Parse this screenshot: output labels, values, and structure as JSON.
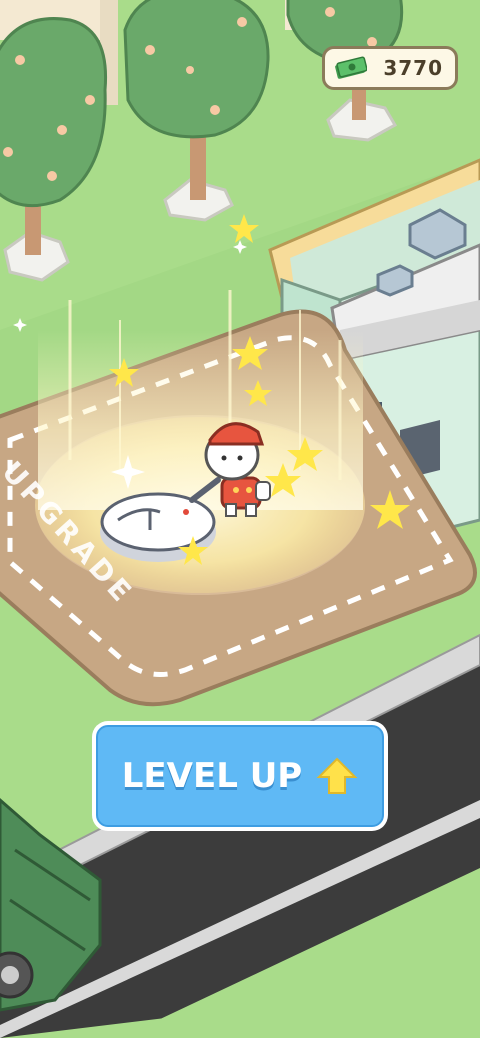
{
  "hud": {
    "money": "3770",
    "money_icon": "cash-icon"
  },
  "actions": {
    "level_up_label": "LEVEL UP",
    "level_up_icon": "up-arrow-icon"
  },
  "scene": {
    "floor_text": "UPGRADE"
  },
  "colors": {
    "grass": "#a9dc8a",
    "road": "#3c3c3c",
    "button_blue": "#5fb9f5",
    "arrow_yellow": "#ffe14a",
    "glow": "#fff4b0"
  }
}
